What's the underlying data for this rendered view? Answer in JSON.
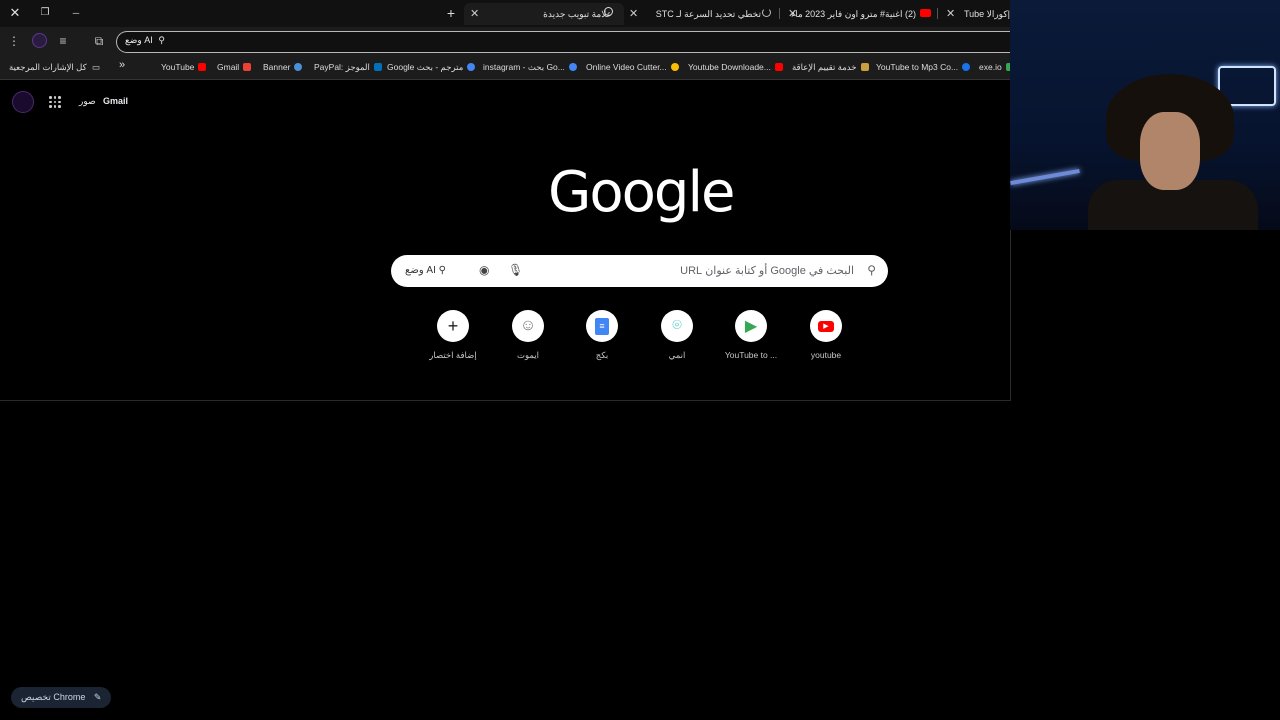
{
  "window": {
    "close": "✕",
    "restore": "❐",
    "minimize": "─"
  },
  "tabs": [
    {
      "label": "Tube كورالا|",
      "active": false
    },
    {
      "label": "(2) اغنية# مترو اون فاير 2023 ماء",
      "active": false
    },
    {
      "label": "تخطي تحديد السرعة لـ STC",
      "active": false
    },
    {
      "label": "علامة تبويب جديدة",
      "active": true
    }
  ],
  "newtab": "+",
  "toolbar": {
    "menu": "⋮",
    "omnibox_ai_label": "وضع AI"
  },
  "bookmarks": {
    "all_label": "كل الإشارات المرجعية",
    "overflow": "»",
    "items": [
      {
        "label": "YouTube",
        "color": "#ff0000"
      },
      {
        "label": "Gmail",
        "color": "#ea4335"
      },
      {
        "label": "Banner",
        "color": "#4a90d9"
      },
      {
        "label": "PayPal: الموجز",
        "color": "#0070ba"
      },
      {
        "label": "Google مترجم - بحث",
        "color": "#4285f4"
      },
      {
        "label": "instagram - بحث Go...",
        "color": "#4285f4"
      },
      {
        "label": "Online Video Cutter...",
        "color": "#fbbc05"
      },
      {
        "label": "Youtube Downloade...",
        "color": "#ff0000"
      },
      {
        "label": "خدمة تقييم الإعاقة",
        "color": "#c8a040"
      },
      {
        "label": "YouTube to Mp3 Co...",
        "color": "#1a73e8"
      },
      {
        "label": "exe.io",
        "color": "#34a853"
      }
    ]
  },
  "ntp": {
    "gmail": "Gmail",
    "images": "صور",
    "logo": "Google",
    "search_placeholder": "البحث في Google أو كتابة عنوان URL",
    "ai_mode": "وضع AI",
    "shortcuts": [
      {
        "label": "youtube",
        "icon": "youtube-icon",
        "color": "#ff0000",
        "glyph": "▶"
      },
      {
        "label": "YouTube to ...",
        "icon": "play-arrow-icon",
        "color": "#34a853",
        "glyph": "▶"
      },
      {
        "label": "انمي",
        "icon": "location-pin-icon",
        "color": "#34c3c0",
        "glyph": "⌾"
      },
      {
        "label": "بكج",
        "icon": "docs-icon",
        "color": "#4285f4",
        "glyph": "▤"
      },
      {
        "label": "ايموت",
        "icon": "avatar-icon",
        "color": "#777777",
        "glyph": "☺"
      },
      {
        "label": "إضافة اختصار",
        "icon": "plus-icon",
        "color": "#202124",
        "glyph": "+"
      }
    ],
    "customize": "تخصيص Chrome"
  }
}
